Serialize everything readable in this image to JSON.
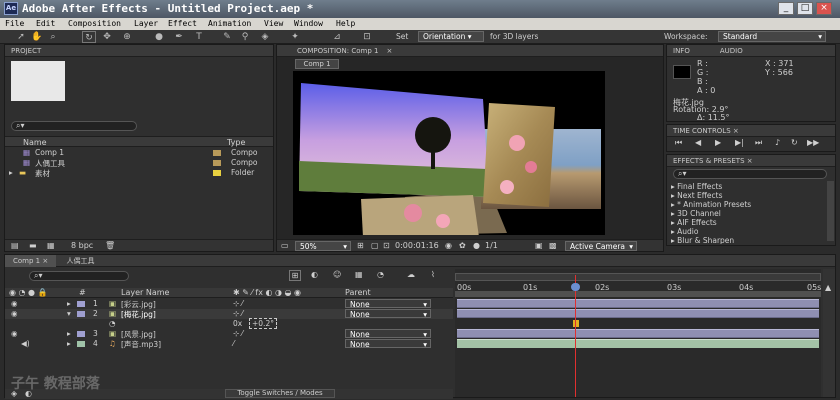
{
  "window": {
    "title": "Adobe After Effects - Untitled Project.aep *",
    "icon": "Ae",
    "min": "_",
    "max": "□",
    "close": "×"
  },
  "menu": [
    "File",
    "Edit",
    "Composition",
    "Layer",
    "Effect",
    "Animation",
    "View",
    "Window",
    "Help"
  ],
  "toolbar": {
    "set_label": "Set",
    "orientation": "Orientation",
    "for3d": "for 3D layers",
    "workspace_label": "Workspace:",
    "workspace_value": "Standard"
  },
  "project": {
    "tab": "PROJECT",
    "col_name": "Name",
    "col_type": "Type",
    "items": [
      {
        "name": "Comp 1",
        "type": "Compo"
      },
      {
        "name": "人偶工具",
        "type": "Compo"
      },
      {
        "name": "素材",
        "type": "Folder"
      }
    ],
    "bpc": "8 bpc"
  },
  "composition": {
    "tab": "COMPOSITION: Comp 1",
    "subtab": "Comp 1",
    "zoom": "50%",
    "timecode": "0:00:01:16",
    "resolution": "1/1",
    "camera": "Active Camera"
  },
  "info": {
    "tab": "INFO",
    "audio_tab": "AUDIO",
    "r": "R :",
    "g": "G :",
    "b": "B :",
    "a": "A : 0",
    "x": "X : 371",
    "y": "Y : 566",
    "file": "梅花.jpg",
    "rotation": "Rotation: 2.9°",
    "delta": "Δ: 11.5°"
  },
  "time_controls": {
    "tab": "TIME CONTROLS"
  },
  "effects": {
    "tab": "EFFECTS & PRESETS",
    "items": [
      "Final Effects",
      "Next Effects",
      "* Animation Presets",
      "3D Channel",
      "AIF Effects",
      "Audio",
      "Blur & Sharpen"
    ]
  },
  "timeline": {
    "tab1": "Comp 1",
    "tab2": "人偶工具",
    "col_layer": "Layer Name",
    "col_parent": "Parent",
    "ruler": [
      "00s",
      "01s",
      "02s",
      "03s",
      "04s",
      "05s"
    ],
    "layers": [
      {
        "num": "1",
        "name": "[彩云.jpg]",
        "parent": "None"
      },
      {
        "num": "2",
        "name": "[梅花.jpg]",
        "parent": "None"
      },
      {
        "num": "3",
        "name": "[风景.jpg]",
        "parent": "None"
      },
      {
        "num": "4",
        "name": "[声音.mp3]",
        "parent": "None"
      }
    ],
    "rotation_value": "0x",
    "rotation_deg": "+0.2°",
    "toggle": "Toggle Switches / Modes"
  },
  "watermark": {
    "text": "子午 教程部落"
  }
}
